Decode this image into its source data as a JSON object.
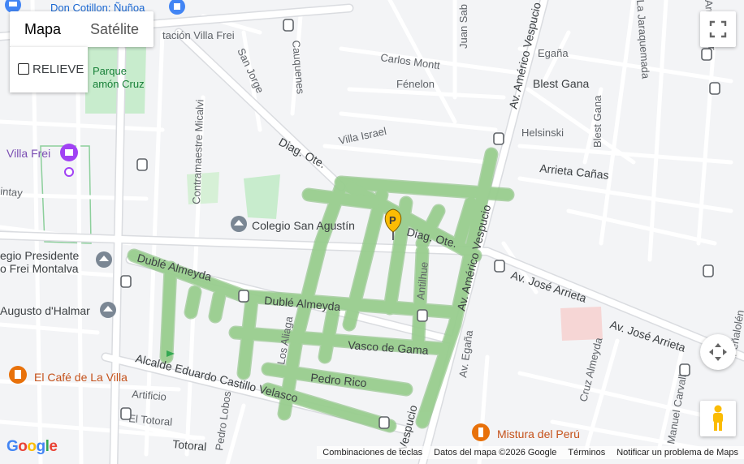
{
  "map_type": {
    "map_label": "Mapa",
    "satellite_label": "Satélite",
    "selected": "Mapa"
  },
  "terrain": {
    "label": "RELIEVE",
    "checked": false
  },
  "streets": {
    "carlos_montt": "Carlos Montt",
    "egana_top": "Egaña",
    "blest_gana": "Blest Gana",
    "fenelon": "Fénelon",
    "helsinski": "Helsinski",
    "blest_gana_v": "Blest Gana",
    "arrieta_canas": "Arrieta Cañas",
    "villa_israel": "Villa Israel",
    "diag_ote_1": "Diag. Ote.",
    "diag_ote_2": "Diag. Ote.",
    "juan_sab": "Juan Sab",
    "san_jorge": "San Jorge",
    "cauquenes": "Cauquenes",
    "contramaestre": "Contramaestre Micalvi",
    "duble_1": "Dublé Almeyda",
    "duble_2": "Dublé Almeyda",
    "vasco": "Vasco de Gama",
    "pedro_rico": "Pedro Rico",
    "alcalde": "Alcalde Eduardo Castillo Velasco",
    "artificio": "Artificio",
    "el_totoral": "El Totoral",
    "totoral": "Totoral",
    "pedro_lobos": "Pedro Lobos",
    "los_aliaga": "Los Aliaga",
    "antilhue": "Antilhue",
    "av_vespucio_1": "Av. Américo Vespucio",
    "av_vespucio_2": "Av. Américo Vespucio",
    "av_vespucio_3": "Vespucio",
    "av_egana": "Av. Egaña",
    "jose_arrieta_1": "Av. José Arrieta",
    "jose_arrieta_2": "Av. José Arrieta",
    "cruz_almeyda": "Cruz Almeyda",
    "manuel_carvallo": "Manuel Carvallo",
    "jaraquemada": "La Jaraquemada",
    "arrieta_sur": "Arrieta Sur",
    "ntay": "intay",
    "penalolen": "Peñalolén"
  },
  "pois": {
    "don_cotillon": "Don Cotillon: Ñuñoa",
    "estacion": "tación Villa Frei",
    "parque_1": "Parque",
    "parque_2": "amón Cruz",
    "villa_frei": "Villa Frei",
    "colegio": "Colegio San Agustín",
    "presidente_1": "egio Presidente",
    "presidente_2": "o Frei Montalva",
    "augusto": "Augusto d'Halmar",
    "cafe": "El Café de La Villa",
    "mistura": "Mistura del Perú"
  },
  "marker": {
    "letter": "P"
  },
  "footer": {
    "shortcuts": "Combinaciones de teclas",
    "map_data": "Datos del mapa ©2026 Google",
    "terms": "Términos",
    "report": "Notificar un problema de Maps"
  },
  "logo": "Google",
  "colors": {
    "zone_fill": "#c3e6b9",
    "park": "#c8eccd",
    "poi_orange": "#e8710a",
    "poi_purple": "#a142f4",
    "marker": "#fbbc04"
  },
  "icons": {
    "fullscreen": "fullscreen-icon",
    "camera": "camera-control-icon",
    "pegman": "pegman-icon",
    "transit": "bus-stop-icon",
    "school": "school-icon",
    "restaurant": "restaurant-icon",
    "shopping": "shopping-icon",
    "marker": "parking-marker-icon"
  }
}
